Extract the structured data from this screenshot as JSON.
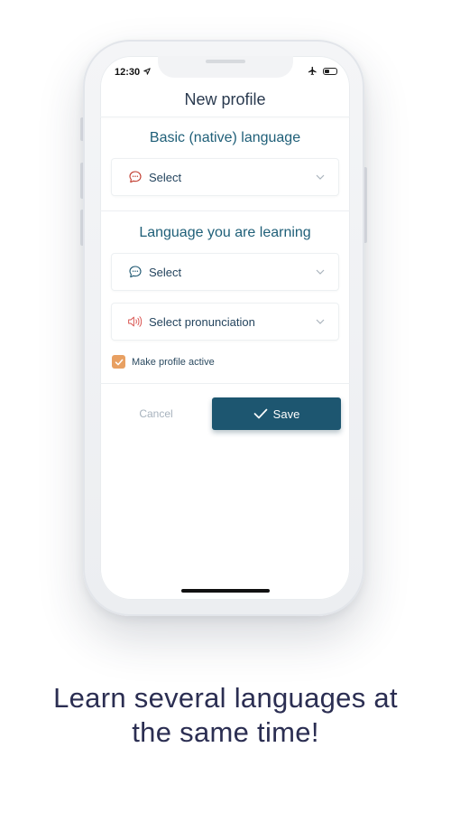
{
  "status_bar": {
    "time": "12:30"
  },
  "header": {
    "title": "New profile"
  },
  "native_section": {
    "heading": "Basic (native) language",
    "select_label": "Select",
    "icon": "chat-bubble-icon",
    "icon_color": "#c0392b"
  },
  "learning_section": {
    "heading": "Language you are learning",
    "select_label": "Select",
    "select_icon": "chat-bubble-icon",
    "pronunciation_label": "Select pronunciation",
    "pronunciation_icon": "speaker-icon",
    "pronunciation_icon_color": "#d9534f"
  },
  "active_toggle": {
    "label": "Make profile active",
    "checked": true
  },
  "actions": {
    "cancel_label": "Cancel",
    "save_label": "Save"
  },
  "tagline": {
    "line1": "Learn several languages at",
    "line2": "the same time!"
  },
  "colors": {
    "primary": "#1d5670",
    "heading": "#1f5f78",
    "checkbox": "#e8a062",
    "tagline": "#2b2e52"
  }
}
